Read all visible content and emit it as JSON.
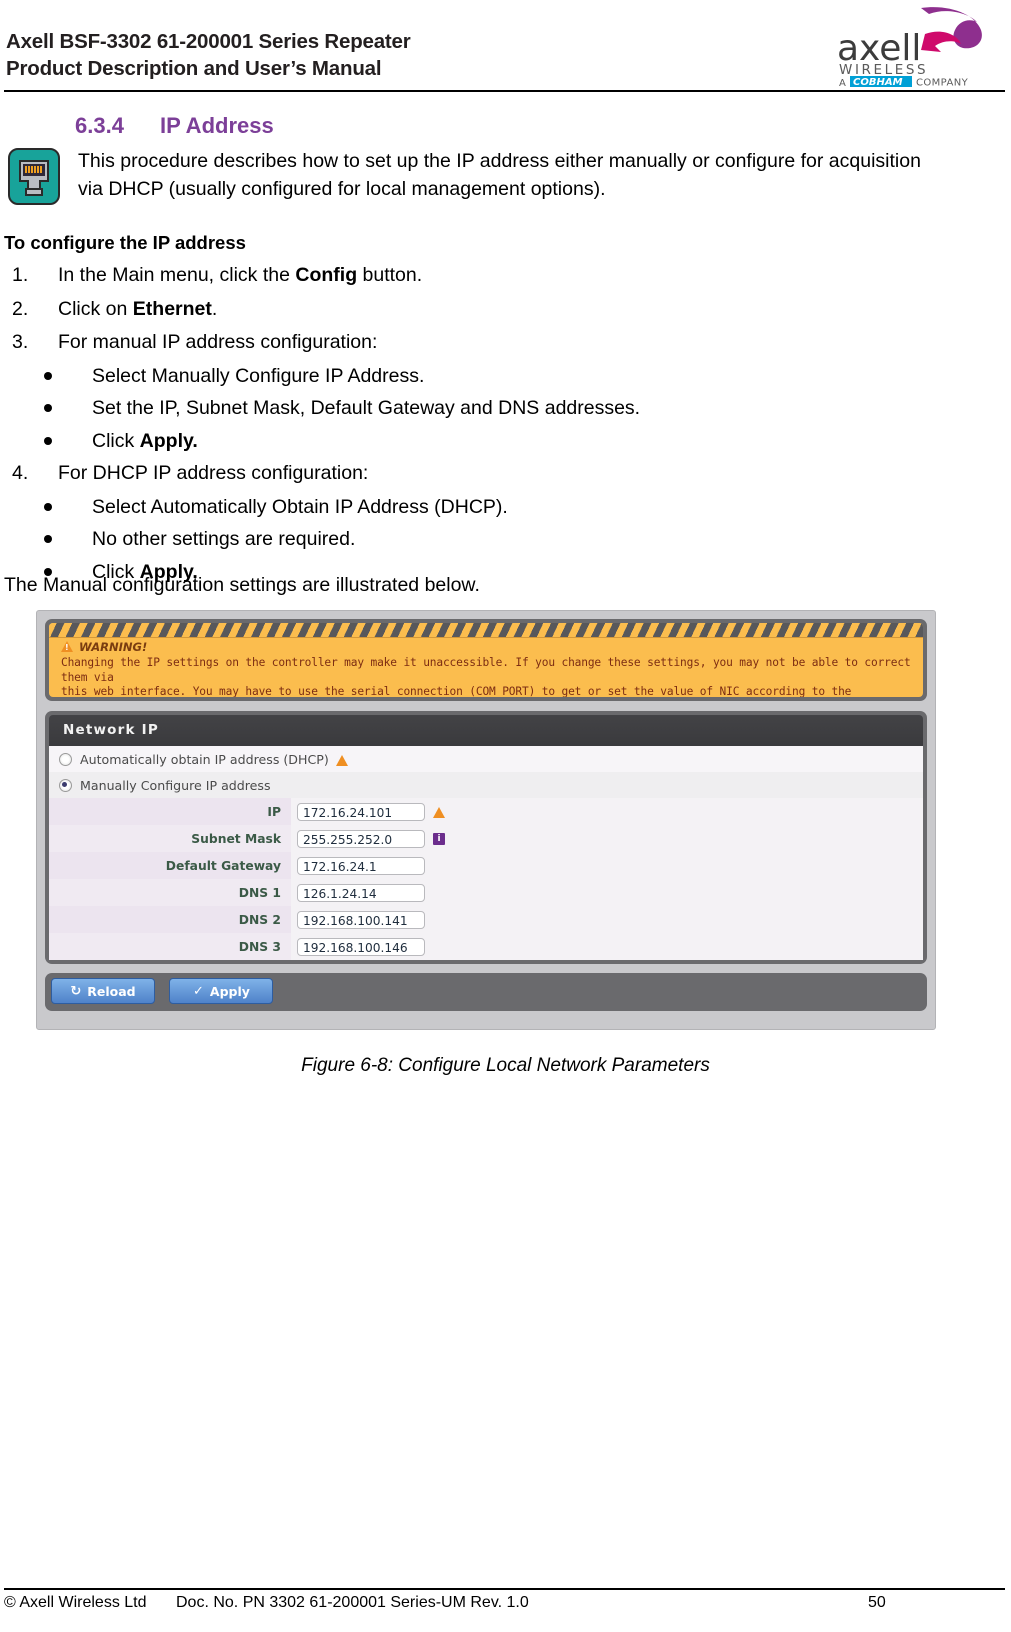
{
  "header": {
    "title_line1": "Axell BSF-3302 61-200001 Series Repeater",
    "title_line2": "Product Description and User’s Manual",
    "logo": {
      "wordmark": "axell",
      "sub1": "WIRELESS",
      "sub2_prefix": "A",
      "sub2_brand": "COBHAM",
      "sub2_suffix": "COMPANY",
      "brand_color": "#8e2f8e",
      "accent_color": "#cf0a6b",
      "cobham_color": "#00a0d6"
    }
  },
  "section": {
    "number": "6.3.4",
    "title": "IP Address",
    "heading_color": "#7c3f98",
    "note_icon": "ethernet-rj45-icon",
    "note_icon_color": "#18a39a",
    "intro": "This procedure describes how to set up the IP address either manually or configure for acquisition via DHCP (usually configured for local management options)."
  },
  "procedure": {
    "subheading": "To configure the IP address",
    "steps": [
      {
        "num": "1.",
        "text_before": "In the Main menu, click the ",
        "bold": "Config",
        "text_after": " button.",
        "bullets": []
      },
      {
        "num": "2.",
        "text_before": "Click on ",
        "bold": "Ethernet",
        "text_after": ".",
        "bullets": []
      },
      {
        "num": "3.",
        "text_before": "For manual IP address configuration:",
        "bold": "",
        "text_after": "",
        "bullets": [
          {
            "text_before": "Select Manually Configure IP Address.",
            "bold": "",
            "text_after": ""
          },
          {
            "text_before": "Set the IP, Subnet Mask, Default Gateway and DNS addresses.",
            "bold": "",
            "text_after": ""
          },
          {
            "text_before": "Click ",
            "bold": "Apply.",
            "text_after": ""
          }
        ]
      },
      {
        "num": "4.",
        "text_before": "For DHCP IP address configuration:",
        "bold": "",
        "text_after": "",
        "bullets": [
          {
            "text_before": "Select Automatically Obtain IP Address (DHCP).",
            "bold": "",
            "text_after": ""
          },
          {
            "text_before": "No other settings are required.",
            "bold": "",
            "text_after": ""
          },
          {
            "text_before": "Click ",
            "bold": "Apply.",
            "text_after": ""
          }
        ]
      }
    ],
    "closing": "The Manual configuration settings are illustrated below."
  },
  "figure": {
    "caption": "Figure 6-8:  Configure Local Network Parameters",
    "warning": {
      "icon": "warning-triangle-icon",
      "title": "WARNING!",
      "line1": "Changing the IP settings on the controller may make it unaccessible. If you change these settings, you may not be able to correct them via",
      "line2": "this web interface. You may have to use the serial connection (COM PORT) to get or set the value of NIC according to the instructions.",
      "bg_color": "#fbbd4e",
      "text_color": "#7d2d12"
    },
    "panel": {
      "title": "Network IP",
      "radios": [
        {
          "label": "Automatically obtain IP address (DHCP)",
          "selected": false,
          "has_warning": true
        },
        {
          "label": "Manually Configure IP address",
          "selected": true,
          "has_warning": false
        }
      ],
      "fields": [
        {
          "label": "IP",
          "value": "172.16.24.101",
          "badge": "warning-triangle-icon"
        },
        {
          "label": "Subnet Mask",
          "value": "255.255.252.0",
          "badge": "info-icon"
        },
        {
          "label": "Default Gateway",
          "value": "172.16.24.1",
          "badge": ""
        },
        {
          "label": "DNS 1",
          "value": "126.1.24.14",
          "badge": ""
        },
        {
          "label": "DNS 2",
          "value": "192.168.100.141",
          "badge": ""
        },
        {
          "label": "DNS 3",
          "value": "192.168.100.146",
          "badge": ""
        }
      ],
      "buttons": [
        {
          "label": "Reload",
          "icon": "refresh-icon",
          "glyph": "↻"
        },
        {
          "label": "Apply",
          "icon": "check-icon",
          "glyph": "✓"
        }
      ]
    }
  },
  "footer": {
    "copyright": "© Axell Wireless Ltd",
    "doc_ref": "Doc. No. PN 3302 61-200001 Series-UM Rev. 1.0",
    "page_number": "50"
  }
}
